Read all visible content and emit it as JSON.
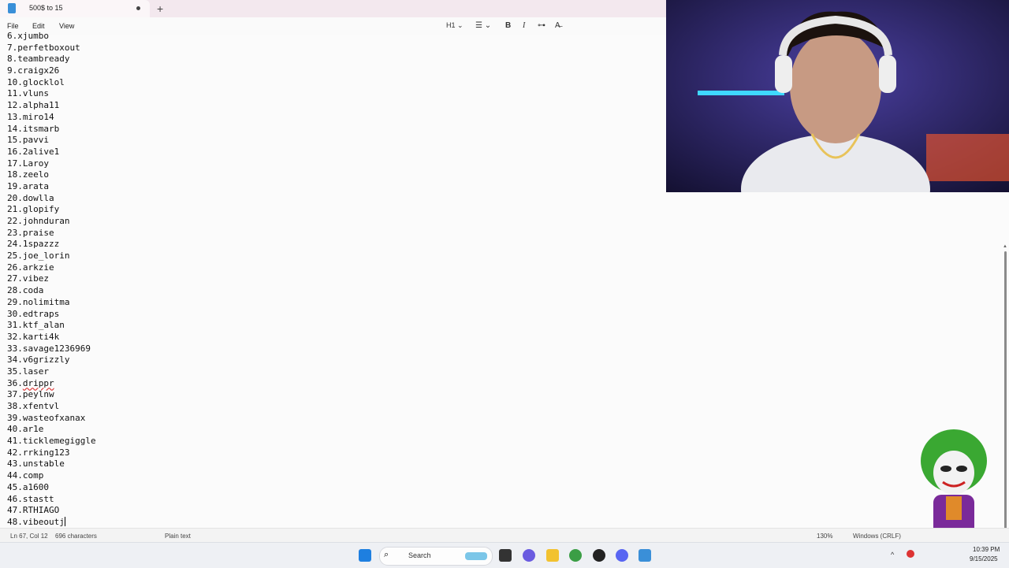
{
  "tab": {
    "title": "500$ to 15"
  },
  "menu": [
    "File",
    "Edit",
    "View"
  ],
  "toolbar": {
    "heading": "H1"
  },
  "lines": [
    "6.xjumbo",
    "7.perfetboxout",
    "8.teambready",
    "9.craigx26",
    "10.glocklol",
    "11.vluns",
    "12.alpha11",
    "13.miro14",
    "14.itsmarb",
    "15.pavvi",
    "16.2alive1",
    "17.Laroy",
    "18.zeelo",
    "19.arata",
    "20.dowlla",
    "21.glopify",
    "22.johnduran",
    "23.praise",
    "24.1spazzz",
    "25.joe_lorin",
    "26.arkzie",
    "27.vibez",
    "28.coda",
    "29.nolimitma",
    "30.edtraps",
    "31.ktf_alan",
    "32.karti4k",
    "33.savage1236969",
    "34.v6grizzly",
    "35.laser",
    "36.",
    "37.peylnw",
    "38.xfentvl",
    "39.wasteofxanax",
    "40.ar1e",
    "41.ticklemegiggle",
    "42.rrking123",
    "43.unstable",
    "44.comp",
    "45.a1600",
    "46.stastt",
    "47.RTHIAGO",
    "48.vibeoutj"
  ],
  "misspelled": "drippr",
  "status": {
    "position": "Ln 67, Col 12",
    "characters": "696 characters",
    "format": "Plain text",
    "zoom": "130%",
    "line_ending": "Windows (CRLF)"
  },
  "taskbar": {
    "search_placeholder": "Search",
    "time": "10:39 PM",
    "date": "9/15/2025"
  }
}
